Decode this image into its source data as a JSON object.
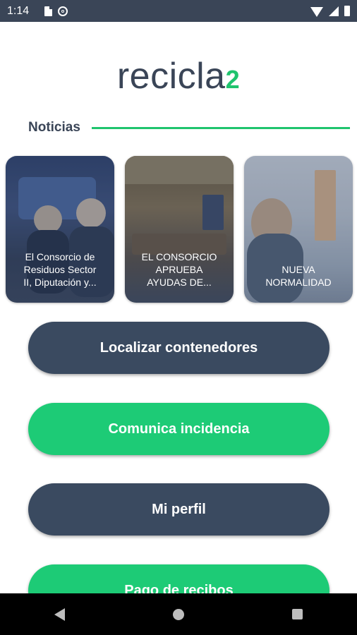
{
  "status_bar": {
    "time": "1:14"
  },
  "logo": {
    "text": "recicla",
    "suffix": "2"
  },
  "news": {
    "title": "Noticias",
    "items": [
      {
        "title": "El Consorcio de\nResiduos Sector\nII, Diputación y..."
      },
      {
        "title": "EL CONSORCIO\nAPRUEBA\nAYUDAS DE..."
      },
      {
        "title": "NUEVA\nNORMALIDAD"
      }
    ]
  },
  "buttons": {
    "locate": "Localizar contenedores",
    "incident": "Comunica incidencia",
    "profile": "Mi perfil",
    "payment": "Pago de recibos"
  },
  "colors": {
    "dark": "#3a4a60",
    "green": "#1dcb76"
  }
}
